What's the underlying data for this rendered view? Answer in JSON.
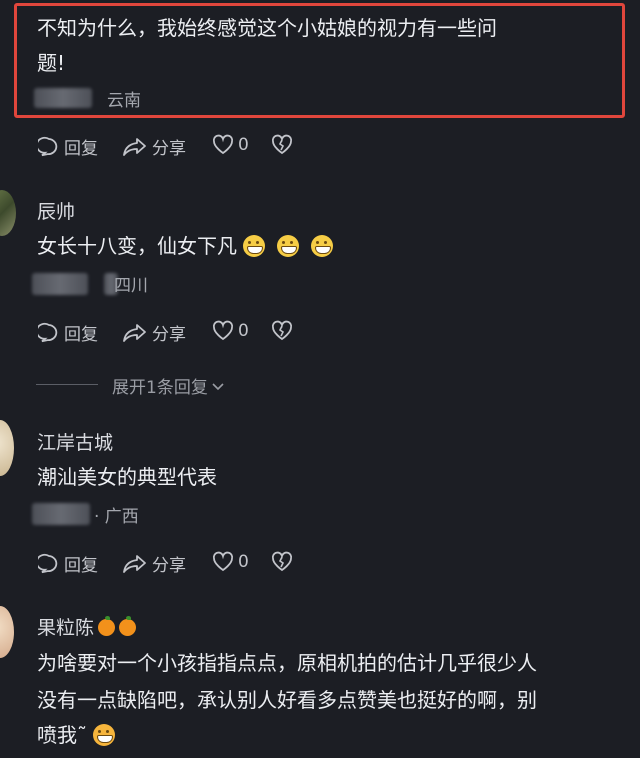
{
  "highlighted_comment": {
    "text_line1": "不知为什么，我始终感觉这个小姑娘的视力有一些问",
    "text_line2": "题!",
    "location": "云南"
  },
  "actions": {
    "reply": "回复",
    "share": "分享",
    "like_count": "0"
  },
  "comments": [
    {
      "user": "辰帅",
      "text": "女长十八变，仙女下凡",
      "location": "四川"
    },
    {
      "user": "江岸古城",
      "text": "潮汕美女的典型代表",
      "location": "· 广西"
    },
    {
      "user": "果粒陈",
      "text_line1": "为啥要对一个小孩指指点点，原相机拍的估计几乎很少人",
      "text_line2": "没有一点缺陷吧，承认别人好看多点赞美也挺好的啊，别",
      "text_line3": "喷我˜"
    }
  ],
  "expand_replies": "展开1条回复",
  "icons": [
    "comment-bubble-icon",
    "share-arrow-icon",
    "heart-icon",
    "broken-heart-icon",
    "chevron-down-icon",
    "grin-emoji-icon",
    "tangerine-emoji-icon",
    "surprised-emoji-icon"
  ],
  "colors": {
    "background": "#1c1e24",
    "highlight_border": "#e0463c"
  }
}
